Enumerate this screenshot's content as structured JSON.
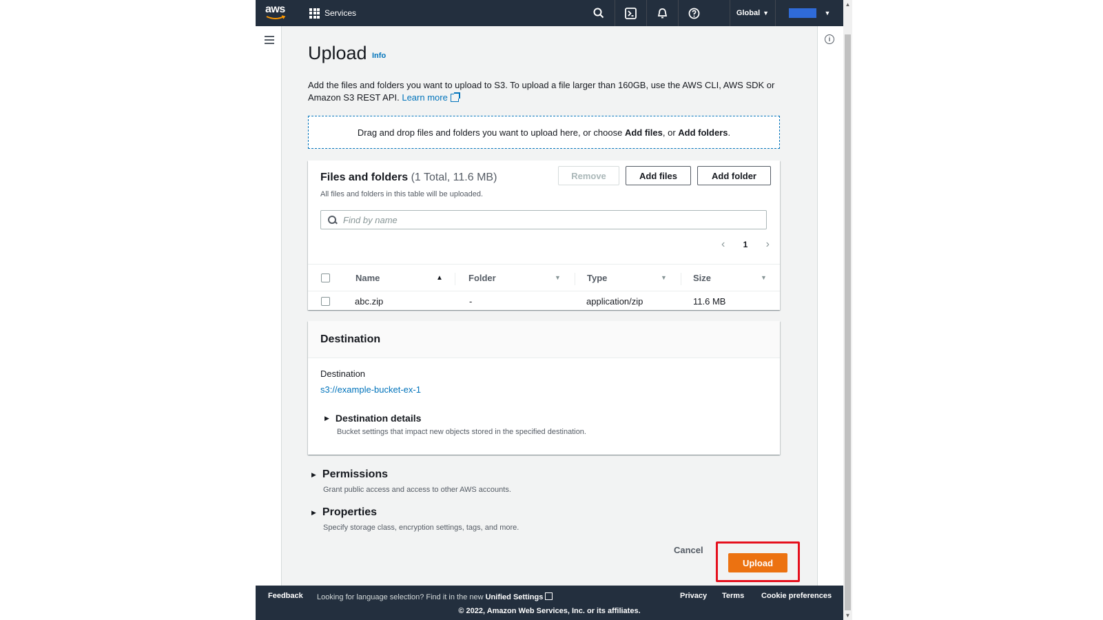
{
  "topbar": {
    "logo_text": "aws",
    "services_label": "Services",
    "region_label": "Global"
  },
  "page": {
    "title": "Upload",
    "info_link": "Info",
    "description": "Add the files and folders you want to upload to S3. To upload a file larger than 160GB, use the AWS CLI, AWS SDK or Amazon S3 REST API.",
    "learn_more": "Learn more"
  },
  "dropzone": {
    "text_before": "Drag and drop files and folders you want to upload here, or choose ",
    "add_files": "Add files",
    "text_middle": ", or ",
    "add_folders": "Add folders",
    "text_after": "."
  },
  "files_panel": {
    "title": "Files and folders",
    "count": "(1 Total, 11.6 MB)",
    "subtitle": "All files and folders in this table will be uploaded.",
    "remove_label": "Remove",
    "add_files_label": "Add files",
    "add_folder_label": "Add folder",
    "search_placeholder": "Find by name",
    "page_number": "1",
    "columns": {
      "name": "Name",
      "folder": "Folder",
      "type": "Type",
      "size": "Size"
    },
    "rows": [
      {
        "name": "abc.zip",
        "folder": "-",
        "type": "application/zip",
        "size": "11.6 MB"
      }
    ]
  },
  "destination": {
    "title": "Destination",
    "label": "Destination",
    "link": "s3://example-bucket-ex-1",
    "details_title": "Destination details",
    "details_sub": "Bucket settings that impact new objects stored in the specified destination."
  },
  "permissions": {
    "title": "Permissions",
    "sub": "Grant public access and access to other AWS accounts."
  },
  "properties": {
    "title": "Properties",
    "sub": "Specify storage class, encryption settings, tags, and more."
  },
  "actions": {
    "cancel_label": "Cancel",
    "upload_label": "Upload",
    "upload_color": "#ec7211",
    "highlight_color": "#e5101d"
  },
  "footer": {
    "feedback": "Feedback",
    "lang_text": "Looking for language selection? Find it in the new ",
    "unified_settings": "Unified Settings",
    "privacy": "Privacy",
    "terms": "Terms",
    "cookie": "Cookie preferences",
    "copyright": "© 2022, Amazon Web Services, Inc. or its affiliates."
  }
}
